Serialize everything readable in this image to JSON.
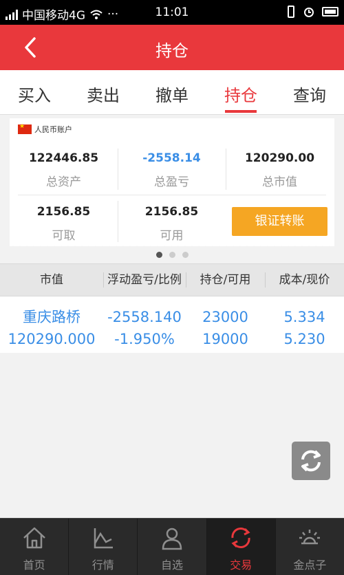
{
  "status": {
    "carrier": "中国移动4G",
    "time": "11:01"
  },
  "header": {
    "title": "持仓"
  },
  "tabs": [
    {
      "label": "买入"
    },
    {
      "label": "卖出"
    },
    {
      "label": "撤单"
    },
    {
      "label": "持仓",
      "active": true
    },
    {
      "label": "查询"
    }
  ],
  "account": {
    "name": "人民币账户",
    "total_assets": {
      "value": "122446.85",
      "label": "总资产"
    },
    "total_pnl": {
      "value": "-2558.14",
      "label": "总盈亏"
    },
    "market_value": {
      "value": "120290.00",
      "label": "总市值"
    },
    "withdrawable": {
      "value": "2156.85",
      "label": "可取"
    },
    "available": {
      "value": "2156.85",
      "label": "可用"
    },
    "transfer_label": "银证转账"
  },
  "table": {
    "headers": [
      "市值",
      "浮动盈亏/比例",
      "持仓/可用",
      "成本/现价"
    ],
    "rows": [
      {
        "name": "重庆路桥",
        "market_value": "120290.000",
        "pnl": "-2558.140",
        "pnl_ratio": "-1.950%",
        "position": "23000",
        "available": "19000",
        "cost": "5.334",
        "price": "5.230"
      }
    ]
  },
  "nav": [
    {
      "label": "首页",
      "icon": "home-icon"
    },
    {
      "label": "行情",
      "icon": "chart-icon"
    },
    {
      "label": "自选",
      "icon": "user-icon"
    },
    {
      "label": "交易",
      "icon": "trade-icon",
      "active": true
    },
    {
      "label": "金点子",
      "icon": "idea-icon"
    }
  ],
  "colors": {
    "brand": "#e9383c",
    "accent_blue": "#3a8ee6",
    "transfer": "#f5a623"
  }
}
